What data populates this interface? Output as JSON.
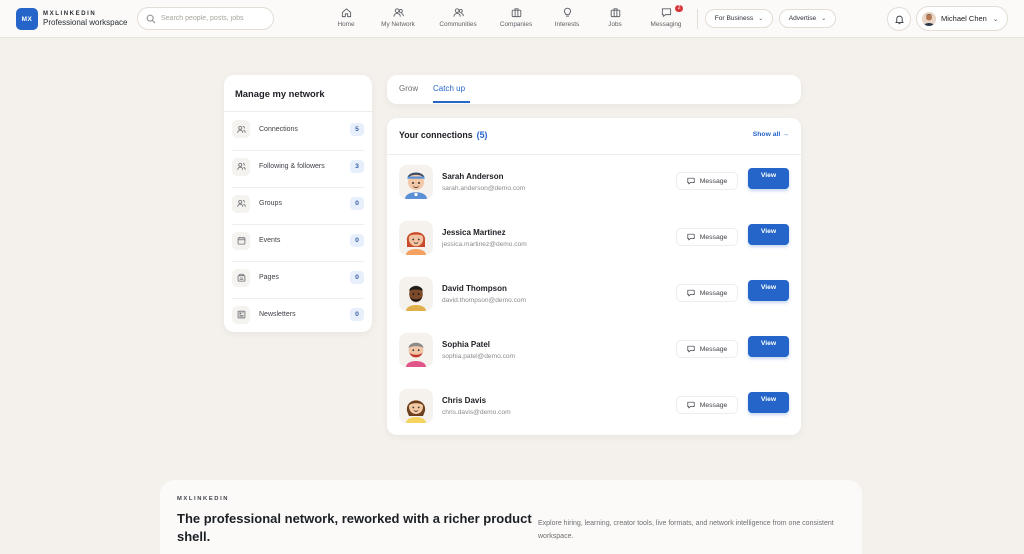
{
  "brand": {
    "logo": "MX",
    "name": "MXLINKEDIN",
    "subtitle": "Professional workspace"
  },
  "search": {
    "placeholder": "Search people, posts, jobs"
  },
  "nav": [
    {
      "label": "Home",
      "icon": "home-icon"
    },
    {
      "label": "My Network",
      "icon": "network-icon"
    },
    {
      "label": "Communities",
      "icon": "communities-icon"
    },
    {
      "label": "Companies",
      "icon": "briefcase-icon"
    },
    {
      "label": "Interests",
      "icon": "lightbulb-icon"
    },
    {
      "label": "Jobs",
      "icon": "jobs-icon"
    },
    {
      "label": "Messaging",
      "icon": "chat-icon",
      "badge": "2"
    }
  ],
  "header": {
    "for_business": "For Business",
    "advertise": "Advertise",
    "user_name": "Michael Chen"
  },
  "sidebar": {
    "title": "Manage my network",
    "items": [
      {
        "label": "Connections",
        "count": "5",
        "icon": "people-icon"
      },
      {
        "label": "Following & followers",
        "count": "3",
        "icon": "people-icon"
      },
      {
        "label": "Groups",
        "count": "0",
        "icon": "people-icon"
      },
      {
        "label": "Events",
        "count": "0",
        "icon": "calendar-icon"
      },
      {
        "label": "Pages",
        "count": "0",
        "icon": "pages-icon"
      },
      {
        "label": "Newsletters",
        "count": "0",
        "icon": "newsletter-icon"
      }
    ]
  },
  "tabs": [
    {
      "label": "Grow",
      "active": false
    },
    {
      "label": "Catch up",
      "active": true
    }
  ],
  "connections": {
    "title": "Your connections",
    "count": "(5)",
    "show_all": "Show all →",
    "message_label": "Message",
    "view_label": "View",
    "items": [
      {
        "name": "Sarah Anderson",
        "email": "sarah.anderson@demo.com"
      },
      {
        "name": "Jessica Martinez",
        "email": "jessica.martinez@demo.com"
      },
      {
        "name": "David Thompson",
        "email": "david.thompson@demo.com"
      },
      {
        "name": "Sophia Patel",
        "email": "sophia.patel@demo.com"
      },
      {
        "name": "Chris Davis",
        "email": "chris.davis@demo.com"
      }
    ]
  },
  "banner": {
    "brand": "MXLINKEDIN",
    "title": "The professional network, reworked with a richer product shell.",
    "description": "Explore hiring, learning, creator tools, live formats, and network intelligence from one consistent workspace."
  },
  "colors": {
    "accent": "#2565c9",
    "background": "#f4f1ec",
    "badge": "#d7393b"
  }
}
